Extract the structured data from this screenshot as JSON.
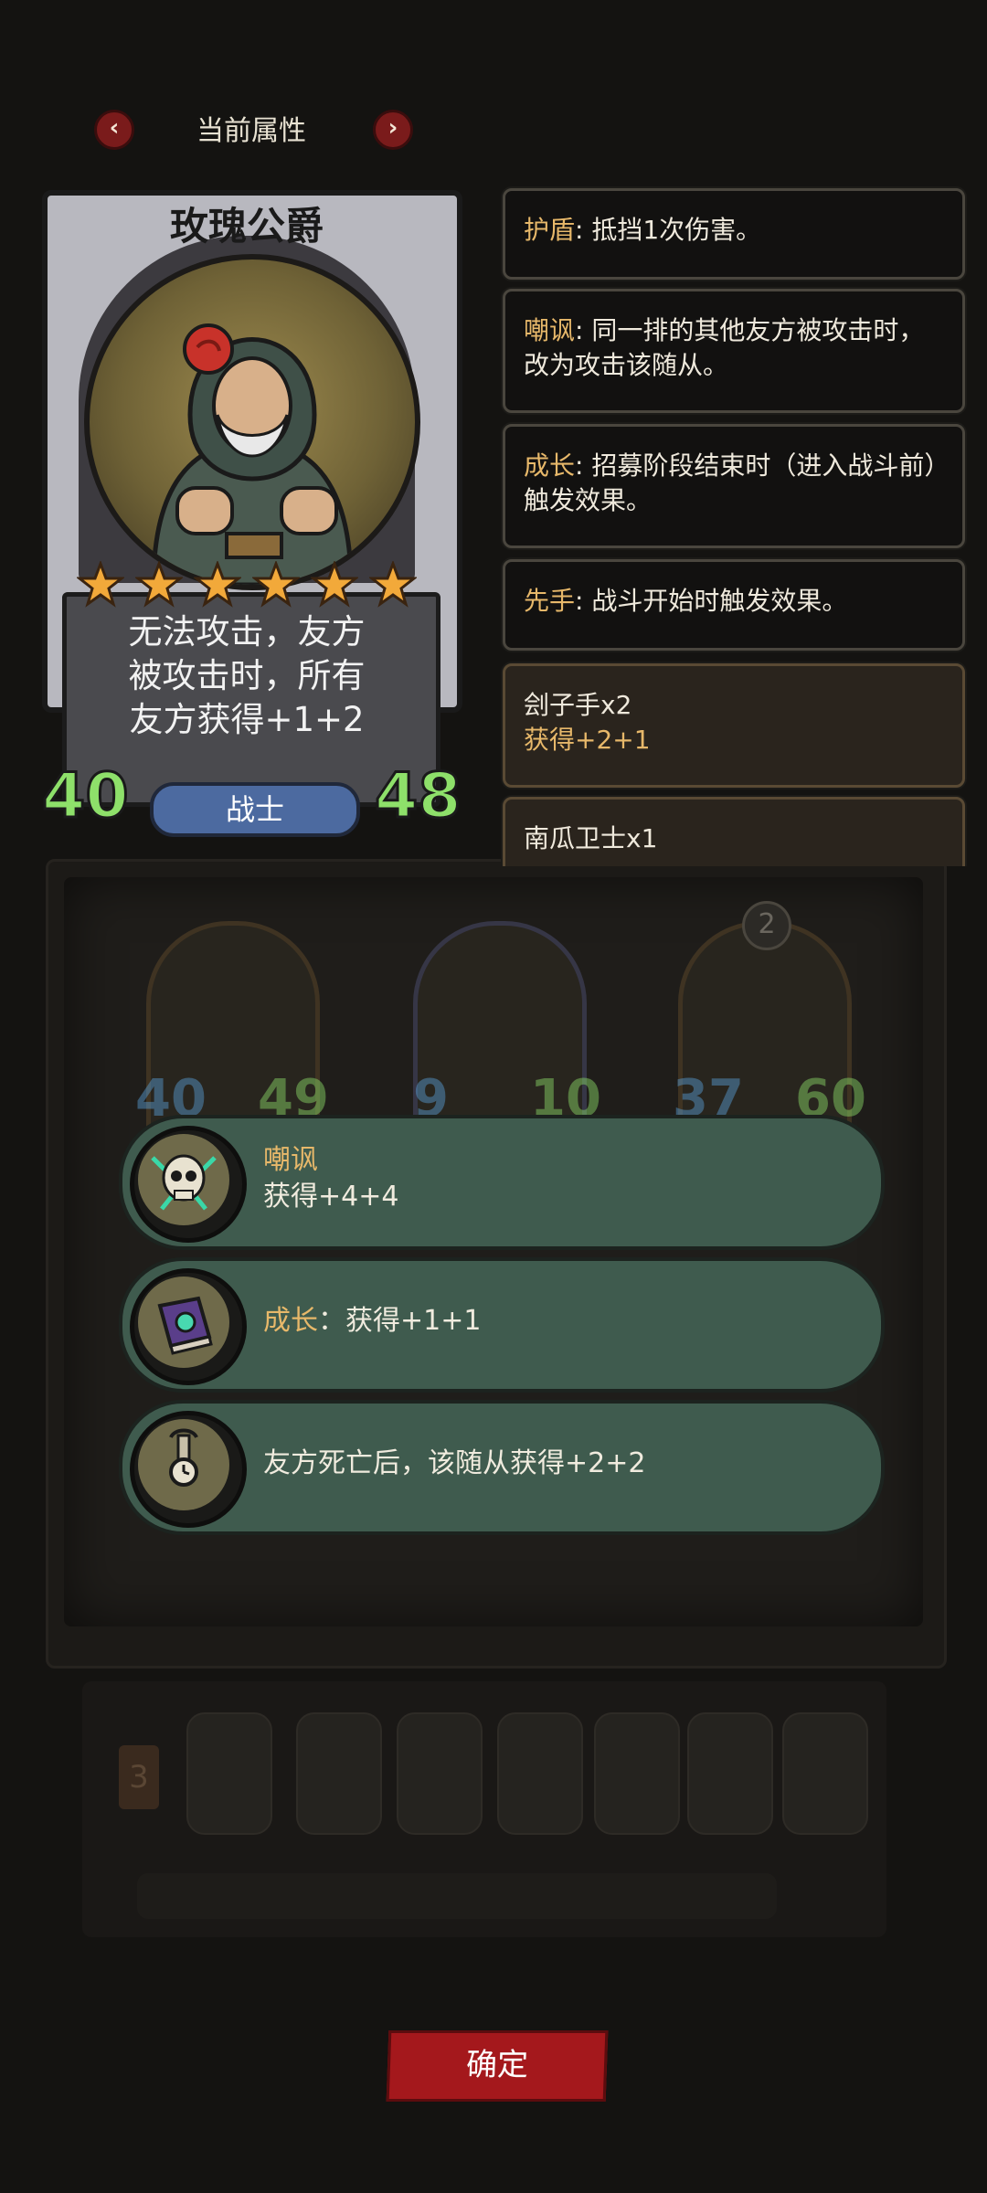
{
  "header": {
    "title": "当前属性",
    "prev_icon": "chevron-left-icon",
    "next_icon": "chevron-right-icon",
    "prev_glyph": "‹",
    "next_glyph": "›"
  },
  "card": {
    "name": "玫瑰公爵",
    "stars": 6,
    "description_lines": [
      "无法攻击，友方",
      "被攻击时，所有",
      "友方获得+1+2"
    ],
    "attack": "40",
    "health": "48",
    "class": "战士"
  },
  "info_boxes": [
    {
      "keyword": "护盾",
      "text": ": 抵挡1次伤害。"
    },
    {
      "keyword": "嘲讽",
      "text": ": 同一排的其他友方被攻击时，改为攻击该随从。"
    },
    {
      "keyword": "成长",
      "text": ": 招募阶段结束时（进入战斗前）触发效果。"
    },
    {
      "keyword": "先手",
      "text": ": 战斗开始时触发效果。"
    }
  ],
  "source_boxes": [
    {
      "title": "刽子手x2",
      "gain": "获得+2+1"
    },
    {
      "title": "南瓜卫士x1",
      "gain": ""
    }
  ],
  "buffs": [
    {
      "icon": "skull-icon",
      "title": "嘲讽",
      "text": "获得+4+4"
    },
    {
      "icon": "spellbook-icon",
      "title": "成长",
      "text": "：获得+1+1"
    },
    {
      "icon": "pocket-watch-icon",
      "title": "",
      "text": "友方死亡后，该随从获得+2+2"
    }
  ],
  "background_board": {
    "heroes": [
      {
        "attack": "40",
        "health": "49"
      },
      {
        "attack": "9",
        "health": "10"
      },
      {
        "attack": "37",
        "health": "60",
        "badge": "2"
      }
    ],
    "tray_badge": "3"
  },
  "confirm_label": "确定",
  "colors": {
    "keyword": "#e7b86a",
    "buff_bg": "#3f5b4e",
    "confirm_red": "#a4181c",
    "stat_green": "#8ee06a",
    "class_blue": "#4c6aa0"
  }
}
